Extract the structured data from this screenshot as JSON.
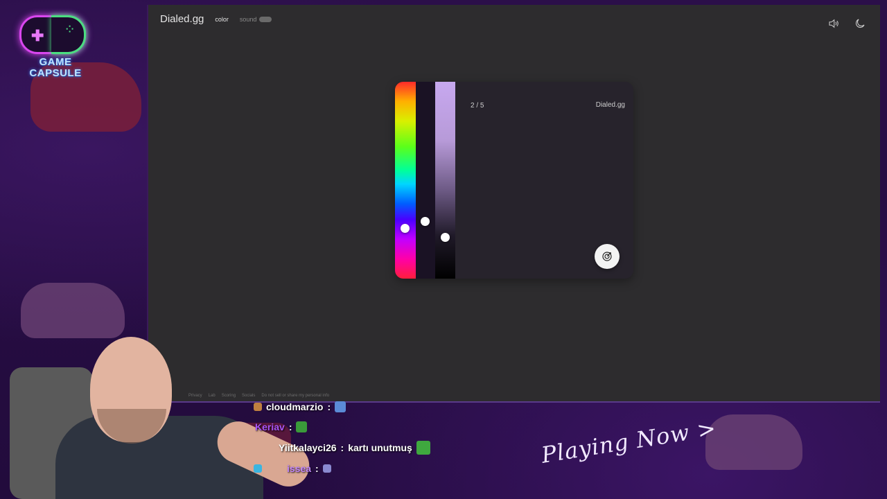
{
  "overlay": {
    "logo_text_line1": "GAME",
    "logo_text_line2": "CAPSULE",
    "playing_now": "Playing Now >"
  },
  "site": {
    "title": "Dialed.gg",
    "nav_color": "color",
    "nav_sound": "sound",
    "round_counter": "2 / 5",
    "card_brand": "Dialed.gg",
    "footer_links": [
      "Privacy",
      "Lab",
      "Scoring",
      "Socials",
      "Do not sell or share my personal info"
    ]
  },
  "chat": [
    {
      "user": "cloudmarzio",
      "message": "",
      "color": "#ffffff"
    },
    {
      "user": "Keriav",
      "message": "",
      "color": "#a855f7"
    },
    {
      "user": "Yiitkalayci26",
      "message": "kartı unutmuş",
      "color": "#ffffff"
    },
    {
      "user": "issea",
      "message": "",
      "color": "#c084fc"
    }
  ],
  "icons": {
    "volume": "volume-icon",
    "theme": "moon-icon",
    "submit": "target-icon"
  },
  "colors": {
    "page_bg": "#2d2c2e",
    "card_bg": "#27232c",
    "accent_purple": "#d946ef",
    "accent_green": "#4ade80"
  }
}
